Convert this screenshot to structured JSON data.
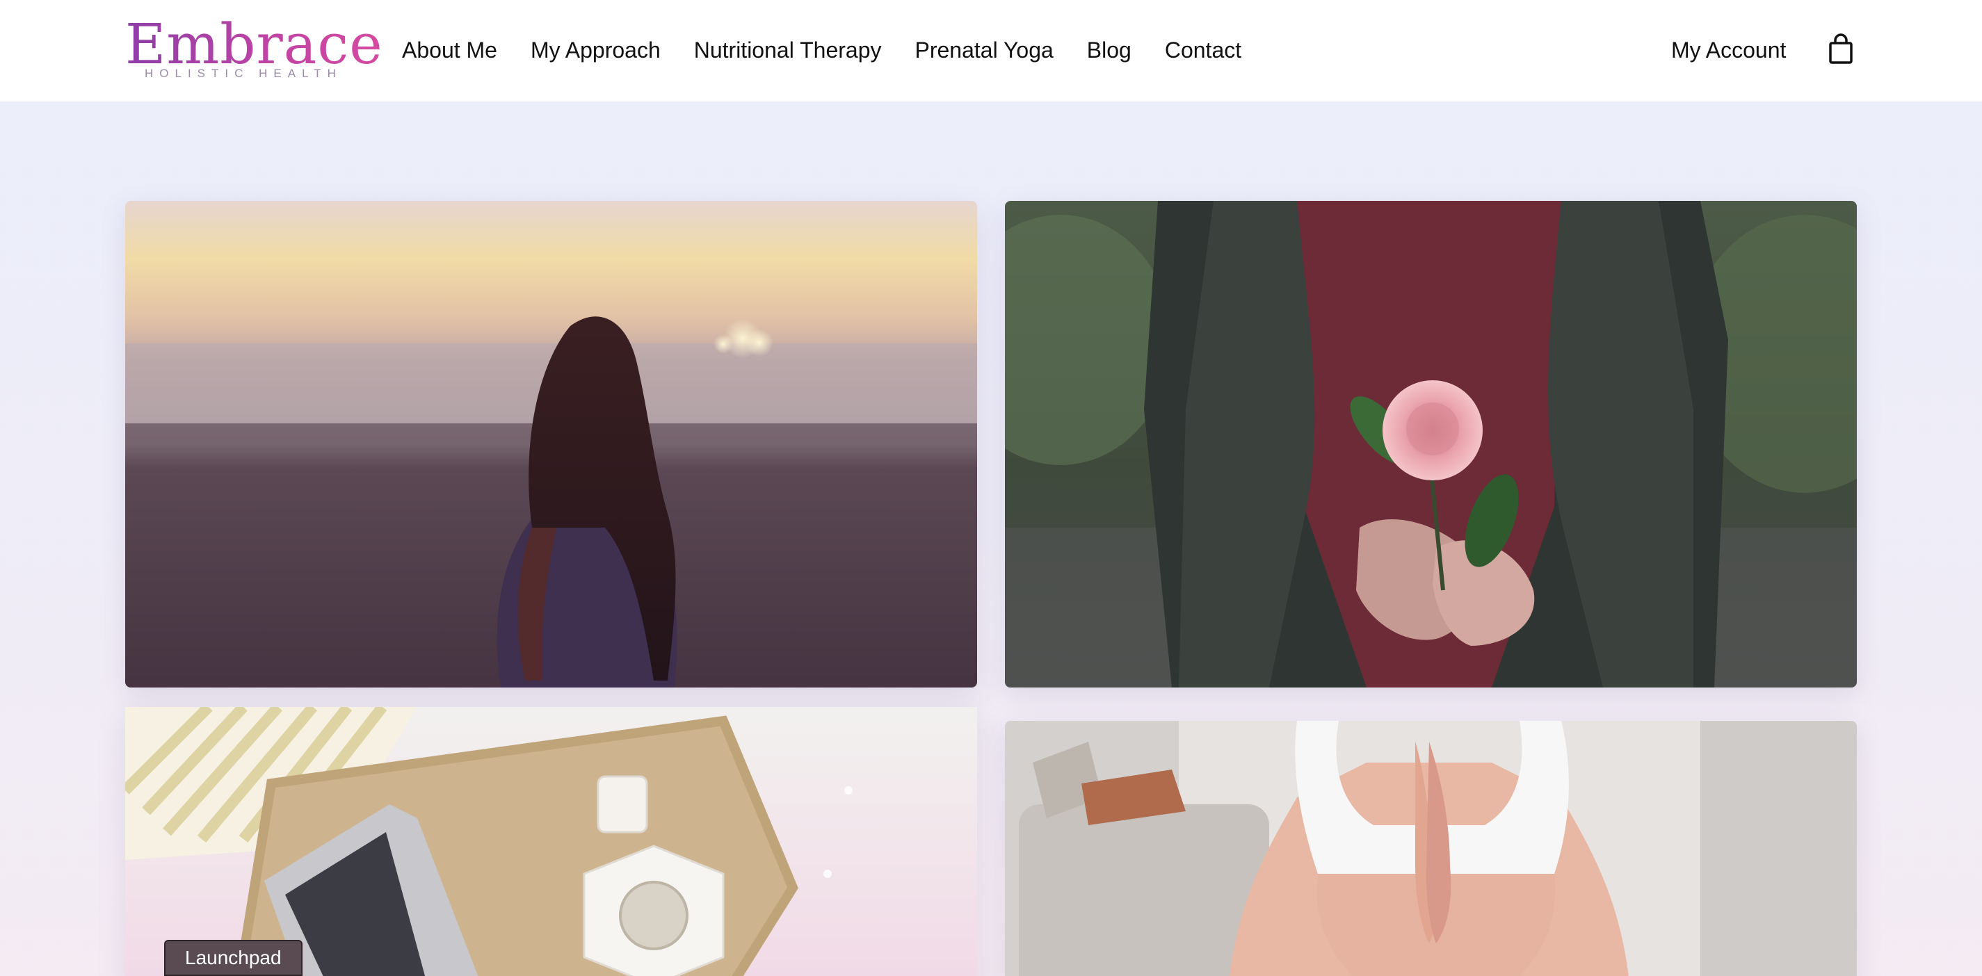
{
  "brand": {
    "name": "Embrace",
    "tagline": "HOLISTIC HEALTH"
  },
  "nav": {
    "items": [
      {
        "label": "About Me"
      },
      {
        "label": "My Approach"
      },
      {
        "label": "Nutritional Therapy"
      },
      {
        "label": "Prenatal Yoga"
      },
      {
        "label": "Blog"
      },
      {
        "label": "Contact"
      }
    ],
    "account_label": "My Account",
    "cart_icon": "shopping-bag-icon"
  },
  "cards": [
    {
      "image": "woman-at-beach-sunset"
    },
    {
      "image": "person-holding-pink-camellia"
    },
    {
      "image": "laptop-on-woven-tray-with-tea"
    },
    {
      "image": "pregnant-woman-prayer-hands"
    }
  ],
  "launchpad": {
    "label": "Launchpad"
  },
  "colors": {
    "logo_gradient_start": "#8e3ea8",
    "logo_gradient_end": "#d54aa0",
    "page_background": "#ebeefb",
    "header_background": "#ffffff"
  }
}
